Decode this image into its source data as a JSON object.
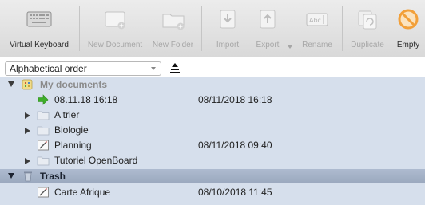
{
  "toolbar": {
    "buttons": [
      {
        "label": "Virtual Keyboard",
        "enabled": true,
        "icon": "keyboard-icon"
      },
      {
        "label": "New Document",
        "enabled": false,
        "icon": "new-document-icon"
      },
      {
        "label": "New Folder",
        "enabled": false,
        "icon": "new-folder-icon"
      },
      {
        "label": "Import",
        "enabled": false,
        "icon": "import-icon"
      },
      {
        "label": "Export",
        "enabled": false,
        "icon": "export-icon"
      },
      {
        "label": "Rename",
        "enabled": false,
        "icon": "rename-icon"
      },
      {
        "label": "Duplicate",
        "enabled": false,
        "icon": "duplicate-icon"
      },
      {
        "label": "Empty",
        "enabled": true,
        "icon": "empty-trash-icon"
      }
    ]
  },
  "sort": {
    "selected": "Alphabetical order",
    "icon": "sort-order-icon"
  },
  "tree": {
    "rows": [
      {
        "label": "My documents",
        "date": "",
        "kind": "group",
        "expanded": true,
        "icon": "documents-group-icon"
      },
      {
        "label": "08.11.18 16:18",
        "date": "08/11/2018 16:18",
        "kind": "current",
        "icon": "current-document-arrow-icon"
      },
      {
        "label": "A trier",
        "date": "",
        "kind": "folder",
        "expanded": false,
        "icon": "folder-icon"
      },
      {
        "label": "Biologie",
        "date": "",
        "kind": "folder",
        "expanded": false,
        "icon": "folder-icon"
      },
      {
        "label": "Planning",
        "date": "08/11/2018 09:40",
        "kind": "document",
        "icon": "document-icon"
      },
      {
        "label": "Tutoriel OpenBoard",
        "date": "",
        "kind": "folder",
        "expanded": false,
        "icon": "folder-icon"
      },
      {
        "label": "Trash",
        "date": "",
        "kind": "trash",
        "expanded": true,
        "icon": "trash-icon"
      },
      {
        "label": "Carte Afrique",
        "date": "08/10/2018 11:45",
        "kind": "document",
        "icon": "document-icon"
      }
    ]
  },
  "colors": {
    "tree_background": "#d6dfec",
    "trash_header": "#a5b2c7",
    "disabled_label": "#a7a7a7",
    "current_arrow": "#3fae2a",
    "empty_icon": "#f2a03a"
  }
}
